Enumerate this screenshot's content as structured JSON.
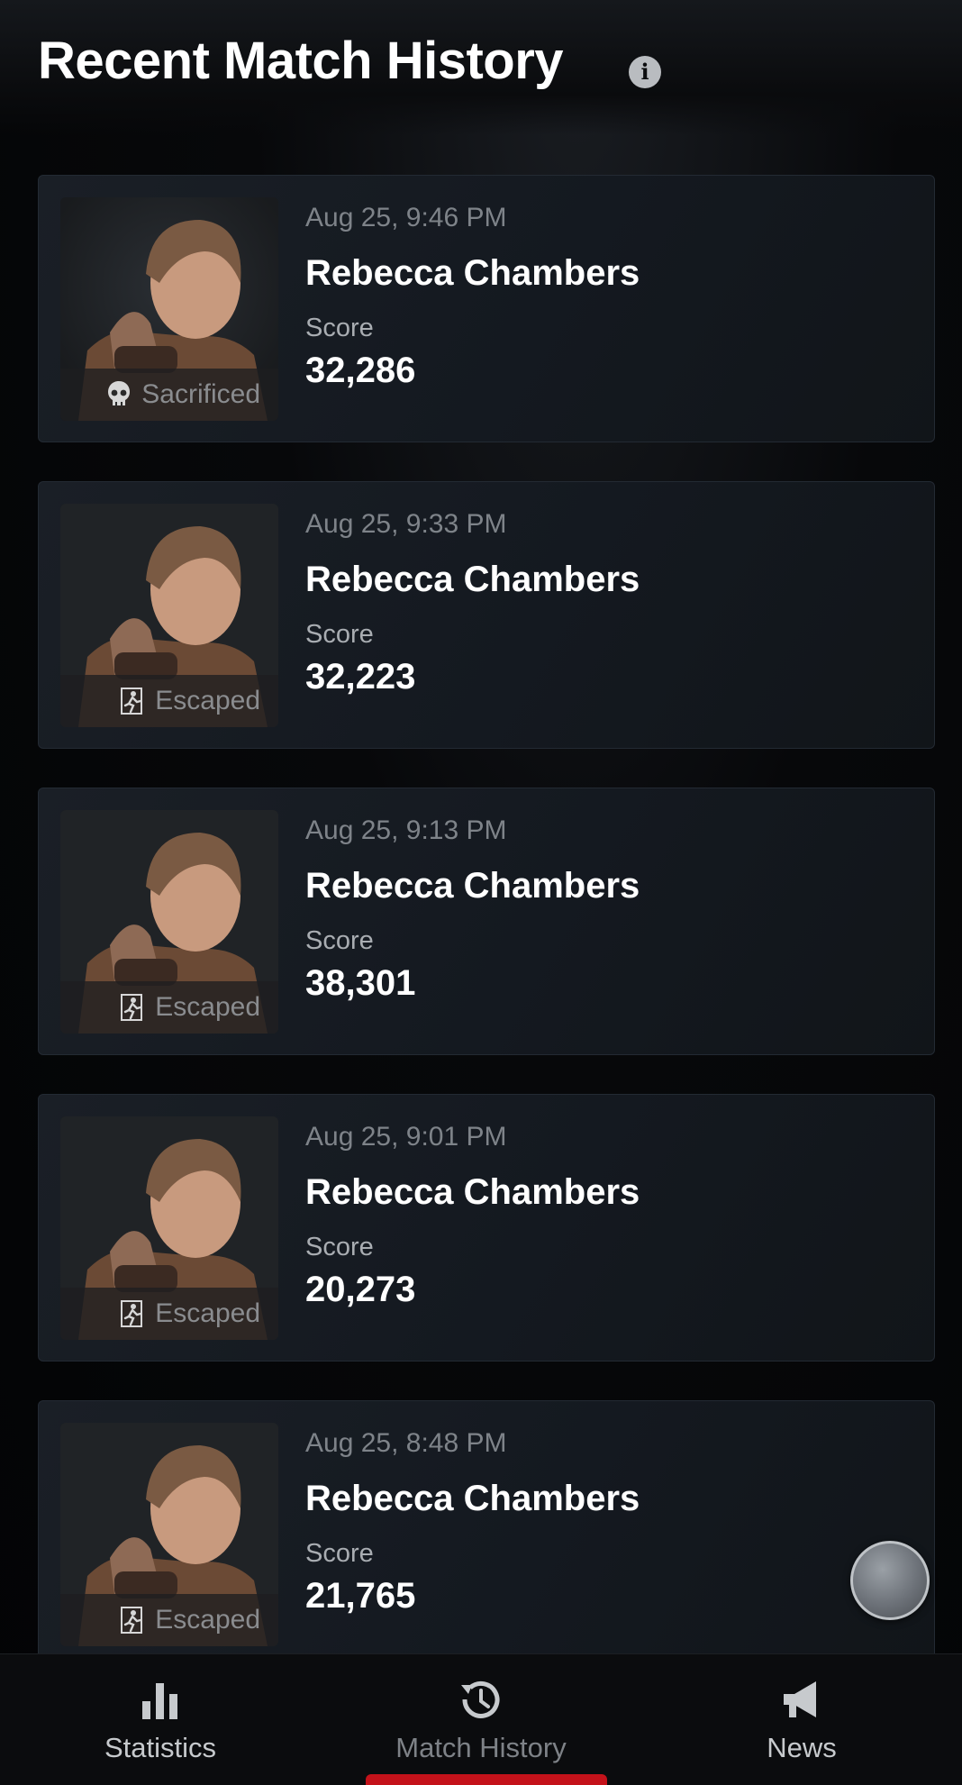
{
  "header": {
    "title": "Recent Match History",
    "info_icon": "info-icon"
  },
  "colors": {
    "accent": "#c4121a",
    "card_bg": "#161b22",
    "muted_text": "#7e8389"
  },
  "matches": [
    {
      "date": "Aug 25, 9:46 PM",
      "character": "Rebecca Chambers",
      "score_label": "Score",
      "score": "32,286",
      "status": "Sacrificed",
      "status_icon": "skull-icon"
    },
    {
      "date": "Aug 25, 9:33 PM",
      "character": "Rebecca Chambers",
      "score_label": "Score",
      "score": "32,223",
      "status": "Escaped",
      "status_icon": "escape-icon"
    },
    {
      "date": "Aug 25, 9:13 PM",
      "character": "Rebecca Chambers",
      "score_label": "Score",
      "score": "38,301",
      "status": "Escaped",
      "status_icon": "escape-icon"
    },
    {
      "date": "Aug 25, 9:01 PM",
      "character": "Rebecca Chambers",
      "score_label": "Score",
      "score": "20,273",
      "status": "Escaped",
      "status_icon": "escape-icon"
    },
    {
      "date": "Aug 25, 8:48 PM",
      "character": "Rebecca Chambers",
      "score_label": "Score",
      "score": "21,765",
      "status": "Escaped",
      "status_icon": "escape-icon"
    }
  ],
  "nav": {
    "items": [
      {
        "label": "Statistics",
        "icon": "bar-chart-icon"
      },
      {
        "label": "Match History",
        "icon": "history-icon",
        "active": true
      },
      {
        "label": "News",
        "icon": "megaphone-icon"
      }
    ]
  }
}
